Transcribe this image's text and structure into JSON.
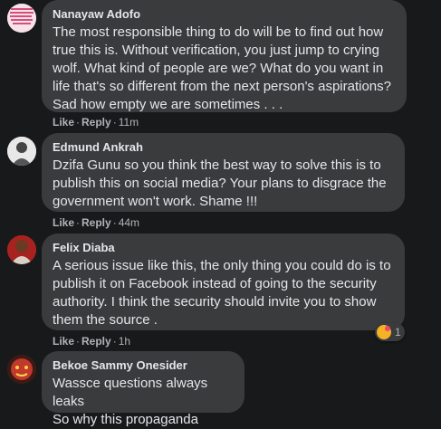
{
  "comments": [
    {
      "author": "Nanayaw Adofo",
      "text": "The most responsible thing to do will be to find out how\ntrue this is. Without verification, you just jump to crying\nwolf. What kind of people are we? What do you want in\nlife that's so different from the next person's aspirations?\nSad how empty we are sometimes . . .",
      "like": "Like",
      "reply": "Reply",
      "time": "11m",
      "avatar_icon": "profile-photo-pink-text"
    },
    {
      "author": "Edmund Ankrah",
      "text": "Dzifa Gunu so you think the best way to solve this is to\npublish this on social media? Your plans to disgrace the\ngovernment won't work. Shame !!!",
      "like": "Like",
      "reply": "Reply",
      "time": "44m",
      "avatar_icon": "profile-photo-person-white"
    },
    {
      "author": "Felix Diaba",
      "text": "A serious issue like this, the only thing you could do is to\npublish it on Facebook instead of going to the security\nauthority. I think the security should invite you to show\nthem the source .",
      "like": "Like",
      "reply": "Reply",
      "time": "1h",
      "avatar_icon": "profile-photo-person-red",
      "reaction_count": "1",
      "reaction_icon": "haha-care-reaction-icon"
    },
    {
      "author": "Bekoe Sammy Onesider",
      "text": "Wassce questions always leaks\nSo why this propaganda",
      "avatar_icon": "profile-photo-red-dark"
    }
  ],
  "colors": {
    "background": "#18191a",
    "bubble": "#3a3b3c",
    "text": "#e4e6eb",
    "meta": "#b0b3b8"
  }
}
